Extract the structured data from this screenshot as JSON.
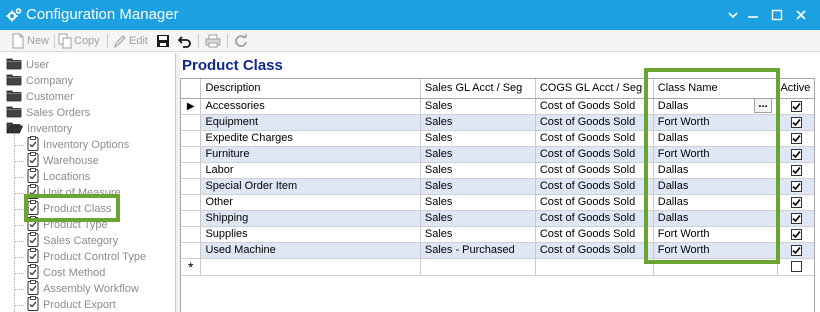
{
  "window": {
    "title": "Configuration Manager",
    "controls": [
      "chevron-down-icon",
      "minimize-icon",
      "maximize-icon",
      "close-icon"
    ]
  },
  "toolbar": {
    "new_label": "New",
    "copy_label": "Copy",
    "edit_label": "Edit"
  },
  "tree": {
    "top_items": [
      "User",
      "Company",
      "Customer",
      "Sales Orders",
      "Inventory"
    ],
    "inventory_children": [
      "Inventory Options",
      "Warehouse",
      "Locations",
      "Unit of Measure",
      "Product Class",
      "Product Type",
      "Sales Category",
      "Product Control Type",
      "Cost Method",
      "Assembly Workflow",
      "Product Export"
    ],
    "selected": "Product Class"
  },
  "panel": {
    "title": "Product Class"
  },
  "grid": {
    "columns": [
      "Description",
      "Sales GL Acct / Seg",
      "COGS GL Acct / Seg",
      "Class Name",
      "Active"
    ],
    "rows": [
      {
        "description": "Accessories",
        "sales": "Sales",
        "cogs": "Cost of Goods Sold",
        "class_name": "Dallas",
        "active": true
      },
      {
        "description": "Equipment",
        "sales": "Sales",
        "cogs": "Cost of Goods Sold",
        "class_name": "Fort Worth",
        "active": true
      },
      {
        "description": "Expedite Charges",
        "sales": "Sales",
        "cogs": "Cost of Goods Sold",
        "class_name": "Dallas",
        "active": true
      },
      {
        "description": "Furniture",
        "sales": "Sales",
        "cogs": "Cost of Goods Sold",
        "class_name": "Fort Worth",
        "active": true
      },
      {
        "description": "Labor",
        "sales": "Sales",
        "cogs": "Cost of Goods Sold",
        "class_name": "Dallas",
        "active": true
      },
      {
        "description": "Special Order Item",
        "sales": "Sales",
        "cogs": "Cost of Goods Sold",
        "class_name": "Dallas",
        "active": true
      },
      {
        "description": "Other",
        "sales": "Sales",
        "cogs": "Cost of Goods Sold",
        "class_name": "Dallas",
        "active": true
      },
      {
        "description": "Shipping",
        "sales": "Sales",
        "cogs": "Cost of Goods Sold",
        "class_name": "Dallas",
        "active": true
      },
      {
        "description": "Supplies",
        "sales": "Sales",
        "cogs": "Cost of Goods Sold",
        "class_name": "Fort Worth",
        "active": true
      },
      {
        "description": "Used Machine",
        "sales": "Sales - Purchased",
        "cogs": "Cost of Goods Sold",
        "class_name": "Fort Worth",
        "active": true
      }
    ],
    "new_row_marker": "*",
    "current_row_marker": "▶",
    "ellipsis_label": "..."
  },
  "colors": {
    "titlebar": "#1ba1e2",
    "highlight": "#6aa532",
    "panel_title": "#0d2a8c",
    "alt_row": "#dfe6f5"
  }
}
